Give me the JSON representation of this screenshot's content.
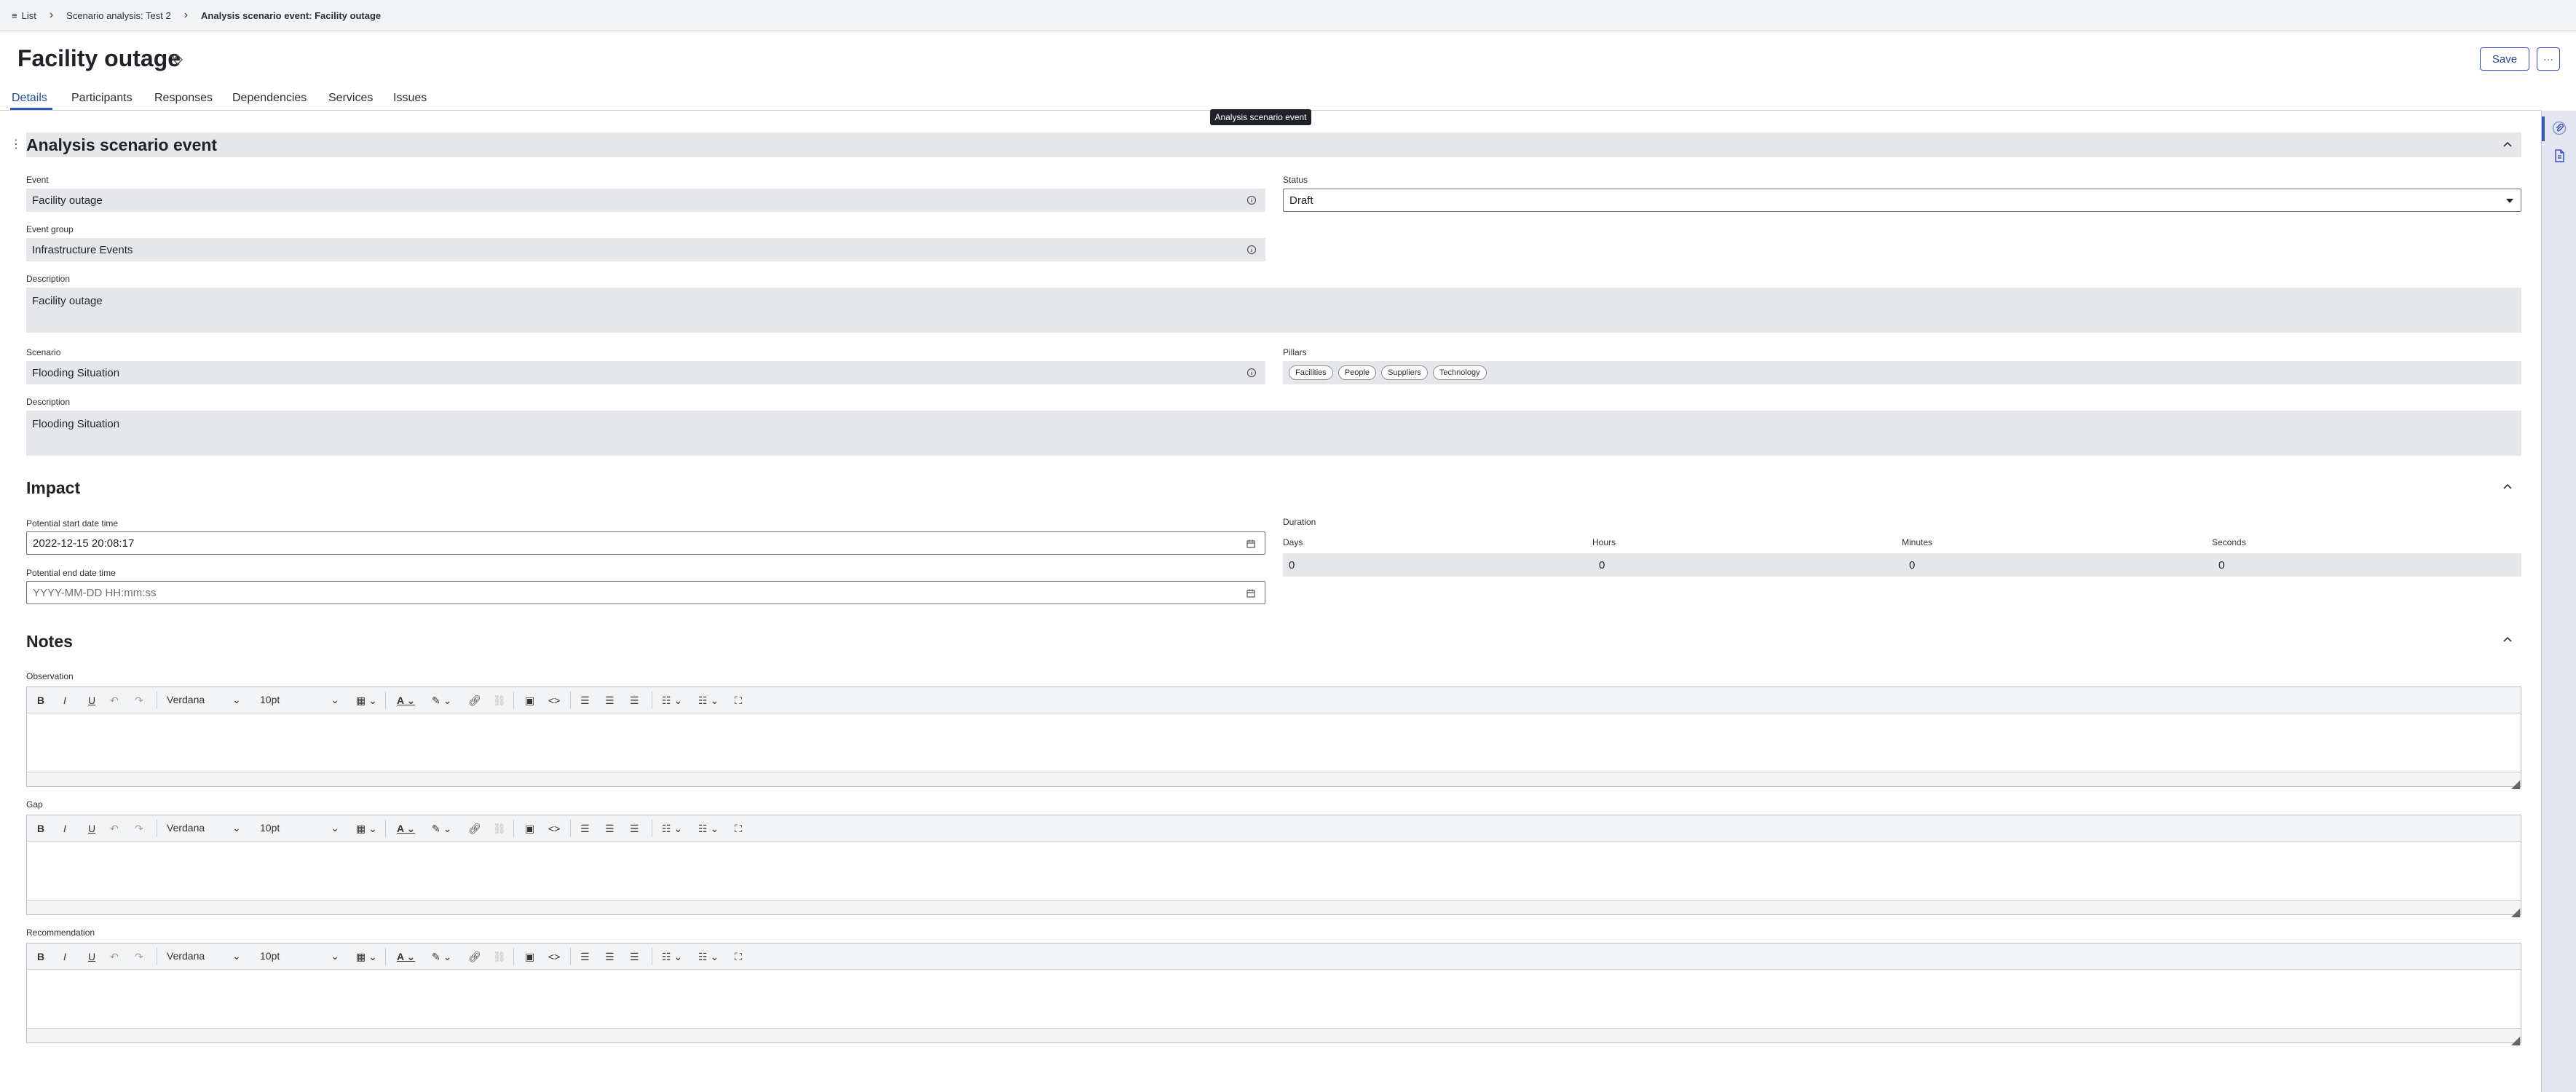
{
  "breadcrumb": {
    "list": "List",
    "scenario": "Scenario analysis: Test 2",
    "current": "Analysis scenario event: Facility outage"
  },
  "header": {
    "title": "Facility outage",
    "save": "Save",
    "more": "···"
  },
  "tabs": [
    "Details",
    "Participants",
    "Responses",
    "Dependencies",
    "Services",
    "Issues"
  ],
  "tooltip": "Analysis scenario event",
  "section_event": {
    "title": "Analysis scenario event",
    "event_label": "Event",
    "event_value": "Facility outage",
    "status_label": "Status",
    "status_value": "Draft",
    "event_group_label": "Event group",
    "event_group_value": "Infrastructure Events",
    "description_label": "Description",
    "description_value": "Facility outage",
    "scenario_label": "Scenario",
    "scenario_value": "Flooding Situation",
    "pillars_label": "Pillars",
    "pillars": [
      "Facilities",
      "People",
      "Suppliers",
      "Technology"
    ],
    "scenario_description_label": "Description",
    "scenario_description_value": "Flooding Situation"
  },
  "section_impact": {
    "title": "Impact",
    "start_label": "Potential start date time",
    "start_value": "2022-12-15 20:08:17",
    "end_label": "Potential end date time",
    "end_placeholder": "YYYY-MM-DD HH:mm:ss",
    "duration_label": "Duration",
    "days_label": "Days",
    "days_value": "0",
    "hours_label": "Hours",
    "hours_value": "0",
    "minutes_label": "Minutes",
    "minutes_value": "0",
    "seconds_label": "Seconds",
    "seconds_value": "0"
  },
  "section_notes": {
    "title": "Notes",
    "observation_label": "Observation",
    "gap_label": "Gap",
    "recommendation_label": "Recommendation",
    "font_family": "Verdana",
    "font_size": "10pt"
  }
}
